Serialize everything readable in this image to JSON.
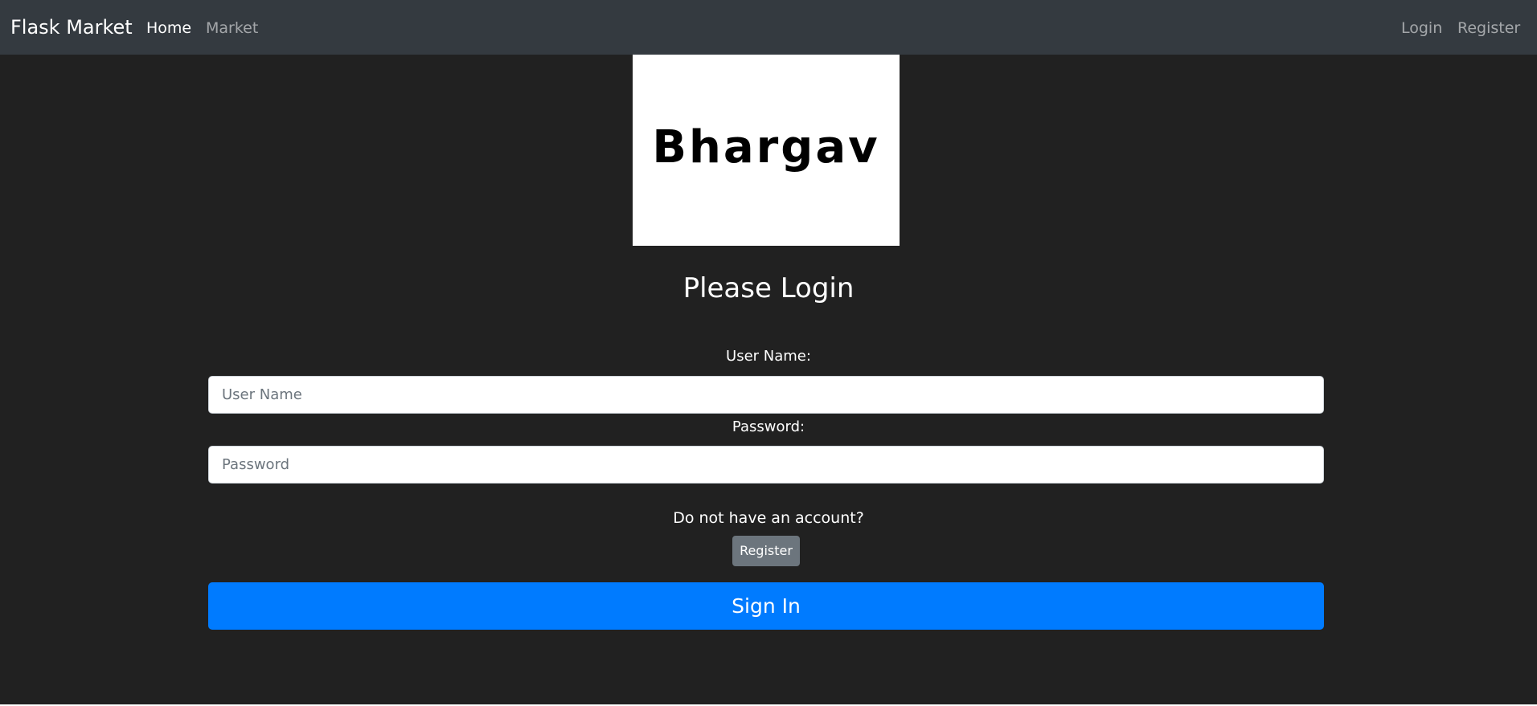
{
  "navbar": {
    "brand": "Flask Market",
    "links": [
      {
        "label": "Home",
        "active": true
      },
      {
        "label": "Market",
        "active": false
      }
    ],
    "right_links": [
      {
        "label": "Login"
      },
      {
        "label": "Register"
      }
    ]
  },
  "logo": {
    "text": "Bhargav"
  },
  "form": {
    "heading": "Please Login",
    "username_label": "User Name:",
    "username_placeholder": "User Name",
    "password_label": "Password:",
    "password_placeholder": "Password",
    "no_account_text": "Do not have an account?",
    "register_button": "Register",
    "signin_button": "Sign In"
  },
  "colors": {
    "navbar_bg": "#343a40",
    "page_bg": "#212121",
    "primary": "#007bff",
    "secondary": "#6c757d"
  }
}
